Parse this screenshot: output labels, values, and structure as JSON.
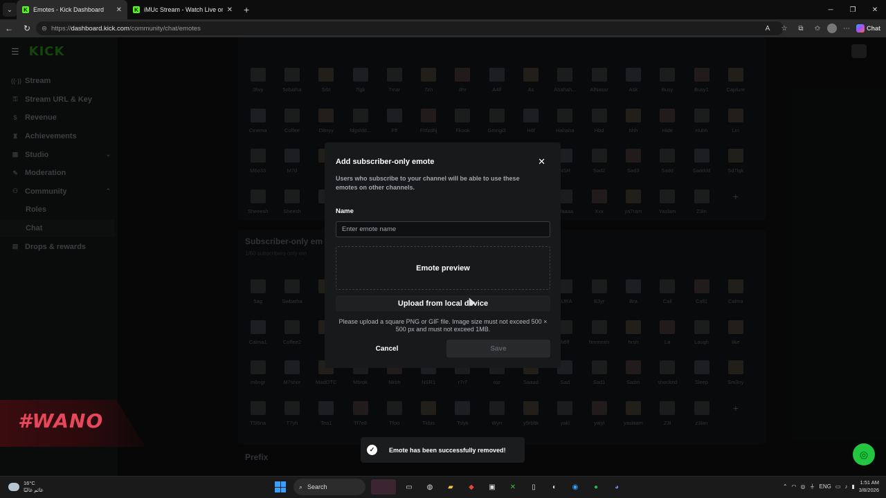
{
  "browser": {
    "tabs": [
      {
        "title": "Emotes - Kick Dashboard",
        "favicon": "K"
      },
      {
        "title": "iMUc Stream - Watch Live on Kick",
        "favicon": "K"
      }
    ],
    "url_prefix": "https://",
    "url_host": "dashboard.kick.com",
    "url_path": "/community/chat/emotes",
    "copilot_label": "Chat"
  },
  "sidebar": {
    "logo": "KICK",
    "items": [
      {
        "label": "Stream",
        "icon": "broadcast-icon"
      },
      {
        "label": "Stream URL & Key",
        "icon": "key-icon"
      },
      {
        "label": "Revenue",
        "icon": "dollar-icon"
      },
      {
        "label": "Achievements",
        "icon": "trophy-icon"
      },
      {
        "label": "Studio",
        "icon": "studio-icon"
      },
      {
        "label": "Moderation",
        "icon": "wrench-icon"
      },
      {
        "label": "Community",
        "icon": "people-icon"
      },
      {
        "label": "Roles"
      },
      {
        "label": "Chat"
      },
      {
        "label": "Drops & rewards",
        "icon": "gift-icon"
      }
    ]
  },
  "emotes_top": [
    "3fwy",
    "5obatha",
    "5rbt",
    "7lgk",
    "7mar",
    "7zn",
    "8hr",
    "A4lf",
    "As",
    "Ahahah...",
    "AlNassr",
    "Ask",
    "Busy",
    "Busy1",
    "Capture",
    "Cinema",
    "Coffee",
    "D8nyy",
    "fdgshfd...",
    "Fff",
    "Fhfzdhj",
    "Fkook",
    "Gmngi3",
    "H6f",
    "Hahaha",
    "Hbd",
    "hhh",
    "Hide",
    "Huhh",
    "Lm",
    "M6o33",
    "M7d",
    "",
    "",
    "",
    "",
    "",
    "",
    "",
    "NSR",
    "Sad2",
    "Sad3",
    "Sadd",
    "Sadddd",
    "Sd7lgk",
    "Sheeesh",
    "Sheesh",
    "",
    "",
    "",
    "",
    "",
    "",
    "",
    "Waaaa",
    "Xxx",
    "ya7ram",
    "Yaslam",
    "Z3ln",
    ""
  ],
  "subscriber_section": {
    "title": "Subscriber-only em",
    "subtitle": "1/60 subscribers only em"
  },
  "emotes_sub": [
    "5ag",
    "Swbatha",
    "7l",
    "",
    "",
    "",
    "",
    "",
    "",
    "AURA",
    "B3yr",
    "Bra",
    "Call",
    "Call1",
    "Calma",
    "Calma1",
    "Coffee2",
    "c",
    "",
    "",
    "",
    "",
    "",
    "",
    "h6ff",
    "hmmmm",
    "hrsh",
    "La",
    "Laugh",
    "like",
    "m6ngr",
    "M7shor",
    "MadOTC",
    "Mbrok",
    "Nkbh",
    "NSR1",
    "r7r7",
    "roz",
    "Saaad",
    "Sad",
    "Sad1",
    "Sadm",
    "shocked",
    "Sleep",
    "Sm3ny",
    "T5l6na",
    "T7yh",
    "Tea1",
    "Tf7e6",
    "Tfoo",
    "Tkbis",
    "Tslyk",
    "Wyn",
    "y5rbltk",
    "yakl",
    "yalyl",
    "yaslaam",
    "Z3l",
    "z3lan",
    ""
  ],
  "prefix_title": "Prefix",
  "modal": {
    "title": "Add subscriber-only emote",
    "description": "Users who subscribe to your channel will be able to use these emotes on other channels.",
    "name_label": "Name",
    "name_placeholder": "Enter emote name",
    "name_value": "",
    "preview_label": "Emote preview",
    "upload_label": "Upload from local device",
    "hint": "Please upload a square PNG or GIF file. Image size must not exceed 500 × 500 px and must not exceed 1MB.",
    "cancel_label": "Cancel",
    "save_label": "Save"
  },
  "toast": {
    "message": "Emote has been successfully removed!"
  },
  "overlay_graphic": {
    "text": "#WANO"
  },
  "taskbar": {
    "temperature": "16°C",
    "weather_desc": "غائم غالبًا",
    "search_label": "Search",
    "language": "ENG",
    "time": "1:51 AM",
    "date": "3/8/2026"
  },
  "colors": {
    "accent": "#53fc18",
    "fab": "#23c640"
  }
}
